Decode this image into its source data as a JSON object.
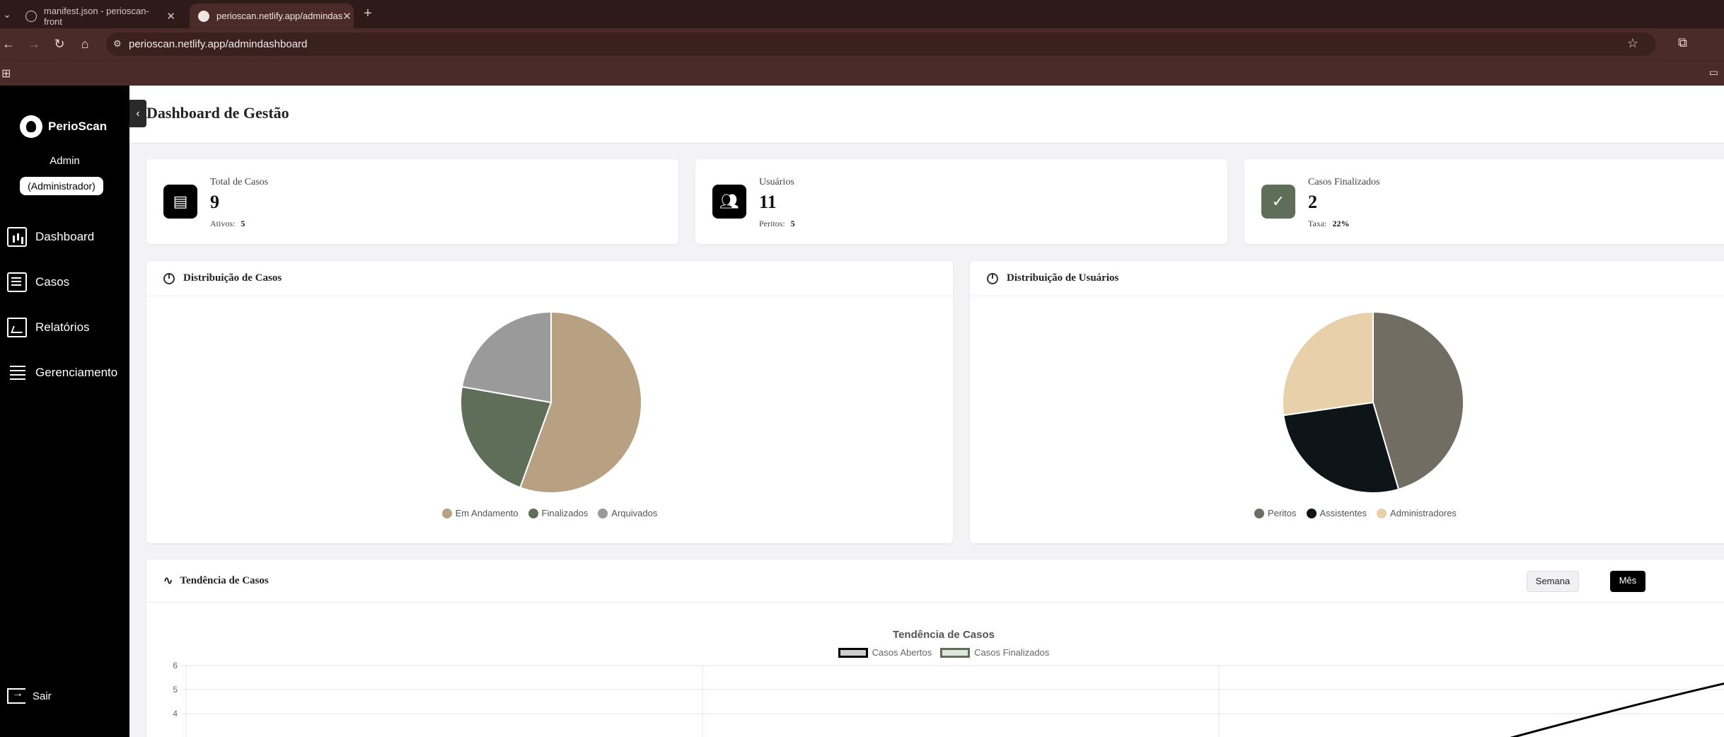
{
  "browser": {
    "tabs": [
      {
        "title": "manifest.json - perioscan-front",
        "active": false
      },
      {
        "title": "perioscan.netlify.app/admindas",
        "active": true
      }
    ],
    "url": "perioscan.netlify.app/admindashboard"
  },
  "sidebar": {
    "brand": "PerioScan",
    "user_name": "Admin",
    "user_role": "(Administrador)",
    "items": [
      {
        "label": "Dashboard",
        "icon": "dashboard-icon"
      },
      {
        "label": "Casos",
        "icon": "cases-icon"
      },
      {
        "label": "Relatórios",
        "icon": "reports-icon"
      },
      {
        "label": "Gerenciamento",
        "icon": "management-icon"
      }
    ],
    "logout_label": "Sair"
  },
  "header": {
    "title": "Dashboard de Gestão"
  },
  "stats": [
    {
      "label": "Total de Casos",
      "value": "9",
      "sub_label": "Ativos:",
      "sub_value": "5",
      "icon": "document-icon",
      "accent": "#000000"
    },
    {
      "label": "Usuários",
      "value": "11",
      "sub_label": "Peritos:",
      "sub_value": "5",
      "icon": "users-icon",
      "accent": "#000000"
    },
    {
      "label": "Casos Finalizados",
      "value": "2",
      "sub_label": "Taxa:",
      "sub_value": "22%",
      "icon": "check-circle-icon",
      "accent": "#5f6e58"
    }
  ],
  "cases_panel": {
    "title": "Distribuição de Casos"
  },
  "users_panel": {
    "title": "Distribuição de Usuários"
  },
  "trend_panel": {
    "title": "Tendência de Casos",
    "range_week": "Semana",
    "range_month": "Mês",
    "selected_range": "Mês"
  },
  "chart_data": [
    {
      "type": "pie",
      "categories": [
        "Em Andamento",
        "Finalizados",
        "Arquivados"
      ],
      "values": [
        5,
        2,
        2
      ],
      "colors": [
        "#b8a083",
        "#5f6e58",
        "#9a9a9a"
      ]
    },
    {
      "type": "pie",
      "categories": [
        "Peritos",
        "Assistentes",
        "Administradores"
      ],
      "values": [
        5,
        3,
        3
      ],
      "colors": [
        "#726d62",
        "#0e1518",
        "#e8d1aa"
      ]
    },
    {
      "type": "line",
      "title": "Tendência de Casos",
      "series": [
        {
          "name": "Casos Abertos",
          "color": "#000000",
          "fill": "#cfcfcf"
        },
        {
          "name": "Casos Finalizados",
          "color": "#5f6e58",
          "fill": "#dfe7dc"
        }
      ],
      "y_ticks": [
        "6",
        "5",
        "4"
      ],
      "ylim": [
        3,
        6
      ],
      "grid": true,
      "legend": "top"
    }
  ]
}
